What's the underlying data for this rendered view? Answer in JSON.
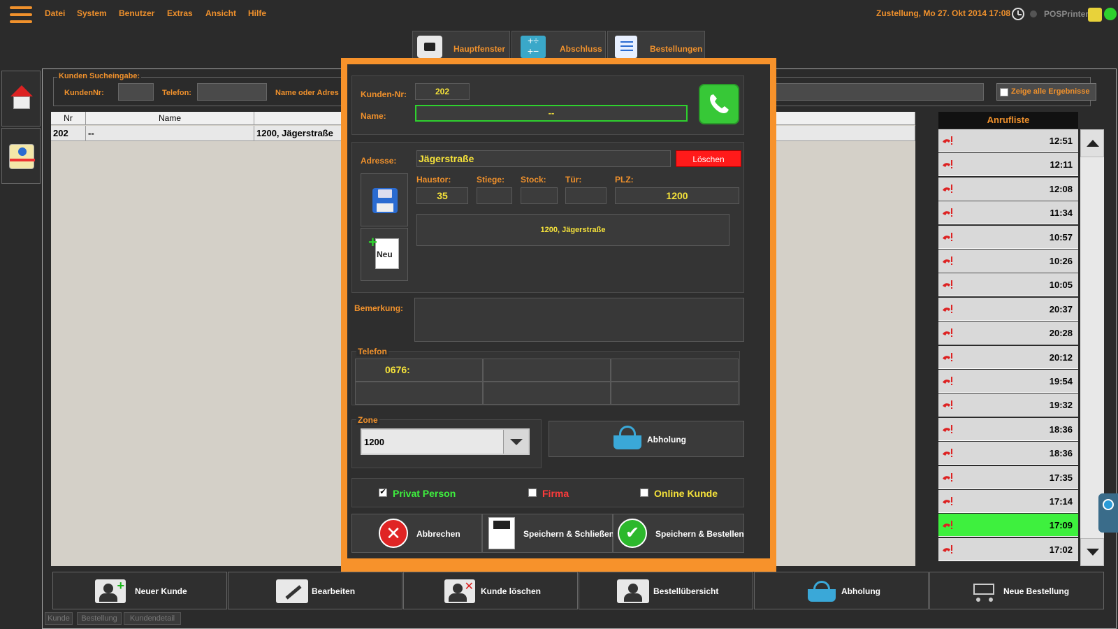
{
  "menu": {
    "items": [
      "Datei",
      "System",
      "Benutzer",
      "Extras",
      "Ansicht",
      "Hilfe"
    ],
    "status": "Zustellung, Mo 27. Okt 2014 17:08",
    "printer": "POSPrinter"
  },
  "tabs": [
    "Hauptfenster",
    "Abschluss",
    "Bestellungen"
  ],
  "search": {
    "title": "Kunden Sucheingabe:",
    "kundennr_label": "KundenNr:",
    "telefon_label": "Telefon:",
    "name_label": "Name oder Adres",
    "show_all": "Zeige alle Ergebnisse"
  },
  "grid": {
    "columns": [
      "Nr",
      "Name",
      ""
    ],
    "rows": [
      {
        "nr": "202",
        "name": "--",
        "address": "1200, Jägerstraße"
      }
    ]
  },
  "calls": {
    "title": "Anrufliste",
    "times": [
      "12:51",
      "12:11",
      "12:08",
      "11:34",
      "10:57",
      "10:26",
      "10:05",
      "20:37",
      "20:28",
      "20:12",
      "19:54",
      "19:32",
      "18:36",
      "18:36",
      "17:35",
      "17:14",
      "17:09",
      "17:02"
    ],
    "active_index": 16
  },
  "toolbar": {
    "buttons": [
      "Neuer Kunde",
      "Bearbeiten",
      "Kunde löschen",
      "Bestellübersicht",
      "Abholung",
      "Neue Bestellung"
    ]
  },
  "bottom_tabs": [
    "Kunde",
    "Bestellung",
    "Kundendetail"
  ],
  "modal": {
    "kunden_nr_label": "Kunden-Nr:",
    "kunden_nr": "202",
    "name_label": "Name:",
    "name": "--",
    "adresse_label": "Adresse:",
    "adresse": "Jägerstraße",
    "loeschen": "Löschen",
    "haustor_label": "Haustor:",
    "stiege_label": "Stiege:",
    "stock_label": "Stock:",
    "tuer_label": "Tür:",
    "plz_label": "PLZ:",
    "haustor": "35",
    "stiege": "",
    "stock": "",
    "tuer": "",
    "plz": "1200",
    "address_summary": "1200, Jägerstraße",
    "neu_label": "Neu",
    "bemerkung_label": "Bemerkung:",
    "bemerkung": "",
    "telefon_title": "Telefon",
    "telefon": [
      "0676:",
      "",
      "",
      "",
      "",
      ""
    ],
    "zone_title": "Zone",
    "zone_value": "1200",
    "abholung": "Abholung",
    "privat": "Privat Person",
    "firma": "Firma",
    "online": "Online Kunde",
    "privat_checked": true,
    "firma_checked": false,
    "online_checked": false,
    "abbrechen": "Abbrechen",
    "speichern_schliessen": "Speichern & Schließen",
    "speichern_bestellen": "Speichern & Bestellen"
  },
  "colors": {
    "accent": "#f0912c",
    "modal_border": "#f7922b",
    "value_yellow": "#f5e23a",
    "active_call": "#3ef03e",
    "delete_red": "#ff1a1a",
    "privat_green": "#3ef03e",
    "firma_red": "#ff3b3b",
    "online_yellow": "#f5e23a"
  }
}
